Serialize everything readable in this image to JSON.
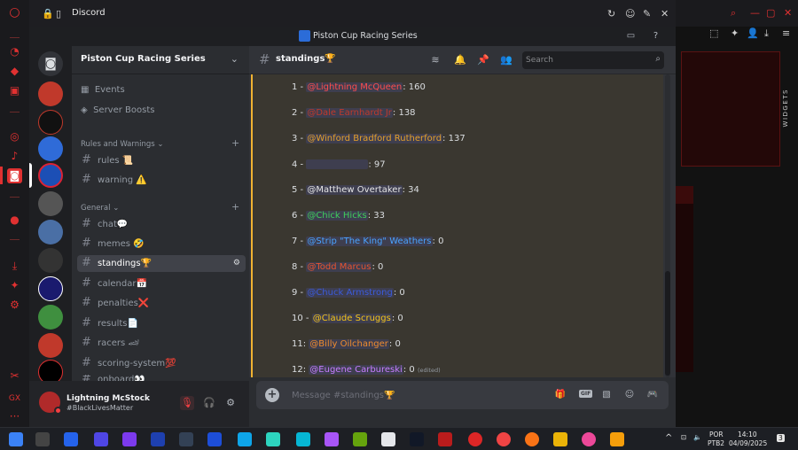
{
  "browser": {
    "tab_title": "Discord",
    "window_title": "Piston Cup Racing Series",
    "widgets_label": "WIDGETS"
  },
  "server": {
    "name": "Piston Cup Racing Series"
  },
  "sidebar": {
    "nav": [
      {
        "label": "Events",
        "icon": "calendar-icon"
      },
      {
        "label": "Server Boosts",
        "icon": "boost-icon"
      }
    ],
    "categories": [
      {
        "label": "Rules and Warnings"
      },
      {
        "label": "General"
      }
    ],
    "channels": [
      {
        "label": "rules",
        "emoji": "📜"
      },
      {
        "label": "warning",
        "emoji": "⚠️"
      },
      {
        "label": "chat",
        "emoji": "💬"
      },
      {
        "label": "memes",
        "emoji": "🤣"
      },
      {
        "label": "standings",
        "emoji": "🏆",
        "selected": true
      },
      {
        "label": "calendar",
        "emoji": "📅"
      },
      {
        "label": "penalties",
        "emoji": "❌"
      },
      {
        "label": "results",
        "emoji": "📄"
      },
      {
        "label": "racers",
        "emoji": "🏎"
      },
      {
        "label": "scoring-system",
        "emoji": "💯"
      },
      {
        "label": "onboard",
        "emoji": "👀"
      }
    ]
  },
  "user": {
    "name": "Lightning McStock",
    "status": "#BlackLivesMatter"
  },
  "chat": {
    "channel_name": "standings",
    "channel_emoji": "🏆",
    "search_placeholder": "Search",
    "composer_placeholder": "Message #standings🏆"
  },
  "standings": [
    {
      "prefix": "1 - ",
      "name": "@Lightning McQueen",
      "suffix": ": 160",
      "color": "#ff4d4d"
    },
    {
      "prefix": "2 - ",
      "name": "@Dale Earnhardt Jr",
      "suffix": ": 138",
      "color": "#c0392b"
    },
    {
      "prefix": "3 - ",
      "name": "@Winford Bradford Rutherford",
      "suffix": ": 137",
      "color": "#e5a02a"
    },
    {
      "prefix": "4 - ",
      "name": "",
      "suffix": ": 97",
      "color": "#3a3730"
    },
    {
      "prefix": "5 - ",
      "name": "@Matthew Overtaker",
      "suffix": ": 34",
      "color": "#e6e6e6"
    },
    {
      "prefix": "6 - ",
      "name": "@Chick Hicks",
      "suffix": ": 33",
      "color": "#3fcf5c"
    },
    {
      "prefix": "7 - ",
      "name": "@Strip \"The King\" Weathers",
      "suffix": ": 0",
      "color": "#4aa3ff"
    },
    {
      "prefix": "8 - ",
      "name": "@Todd Marcus",
      "suffix": ": 0",
      "color": "#e8542f"
    },
    {
      "prefix": "9 - ",
      "name": "@Chuck Armstrong",
      "suffix": ": 0",
      "color": "#3b5bdb"
    },
    {
      "prefix": "10 - ",
      "name": "@Claude Scruggs",
      "suffix": ": 0",
      "color": "#f5c518"
    },
    {
      "prefix": "11: ",
      "name": "@Billy Oilchanger",
      "suffix": ": 0",
      "color": "#f08c2e"
    },
    {
      "prefix": "12: ",
      "name": "@Eugene Carbureski",
      "suffix": ": 0",
      "edited": "(edited)",
      "color": "#c77dff"
    }
  ],
  "taskbar": {
    "lang": "POR",
    "layout": "PTB2",
    "time": "14:10",
    "date": "04/09/2025",
    "notifications": "3"
  },
  "colors": {
    "discord_bg": "#313338",
    "sidebar_bg": "#2b2d31",
    "guild_bg": "#1e1f22",
    "accent_red": "#e03131",
    "highlight_bar": "#f0b232"
  }
}
